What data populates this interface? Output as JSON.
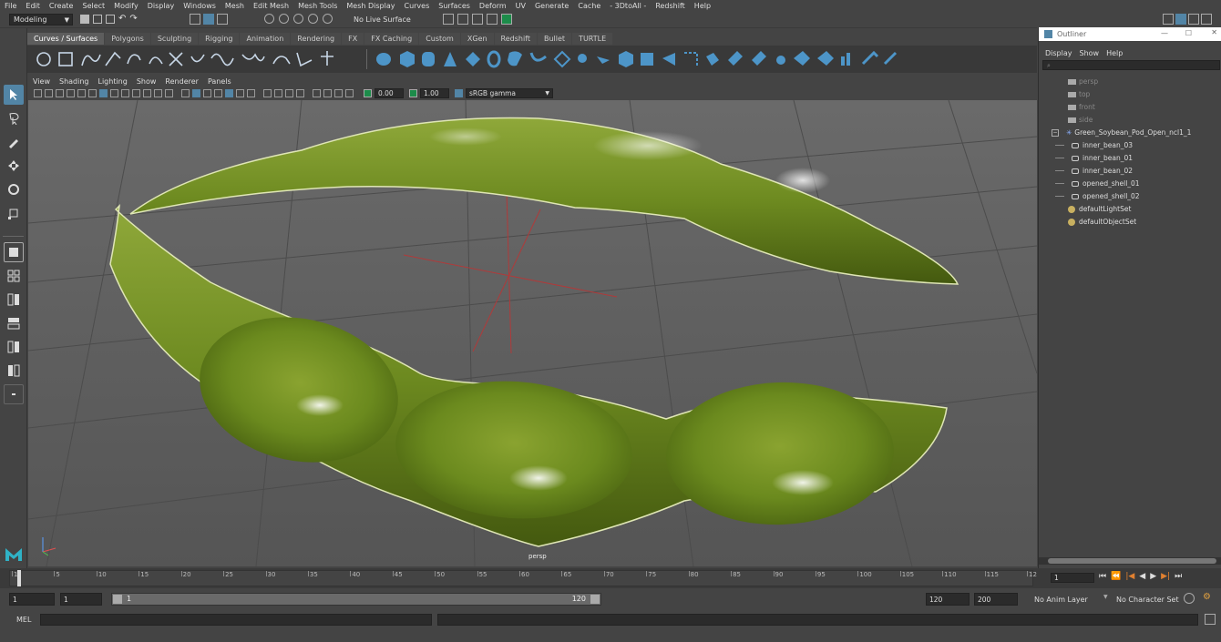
{
  "menu": [
    "File",
    "Edit",
    "Create",
    "Select",
    "Modify",
    "Display",
    "Windows",
    "Mesh",
    "Edit Mesh",
    "Mesh Tools",
    "Mesh Display",
    "Curves",
    "Surfaces",
    "Deform",
    "UV",
    "Generate",
    "Cache",
    "- 3DtoAll -",
    "Redshift",
    "Help"
  ],
  "status": {
    "mode": "Modeling",
    "live_surface": "No Live Surface"
  },
  "shelf_tabs": [
    "Curves / Surfaces",
    "Polygons",
    "Sculpting",
    "Rigging",
    "Animation",
    "Rendering",
    "FX",
    "FX Caching",
    "Custom",
    "XGen",
    "Redshift",
    "Bullet",
    "TURTLE"
  ],
  "panel_menu": [
    "View",
    "Shading",
    "Lighting",
    "Show",
    "Renderer",
    "Panels"
  ],
  "panel_tools": {
    "exposure": "0.00",
    "gamma": "1.00",
    "colorspace": "sRGB gamma"
  },
  "viewport": {
    "camera_label": "persp"
  },
  "outliner": {
    "title": "Outliner",
    "menu": [
      "Display",
      "Show",
      "Help"
    ],
    "cameras": [
      "persp",
      "top",
      "front",
      "side"
    ],
    "group": "Green_Soybean_Pod_Open_ncl1_1",
    "children": [
      "inner_bean_03",
      "inner_bean_01",
      "inner_bean_02",
      "opened_shell_01",
      "opened_shell_02"
    ],
    "sets": [
      "defaultLightSet",
      "defaultObjectSet"
    ]
  },
  "timeline": {
    "ticks": [
      "1",
      "5",
      "10",
      "15",
      "20",
      "25",
      "30",
      "35",
      "40",
      "45",
      "50",
      "55",
      "60",
      "65",
      "70",
      "75",
      "80",
      "85",
      "90",
      "95",
      "100",
      "105",
      "110",
      "115",
      "12"
    ],
    "current_frame": "1"
  },
  "range": {
    "start": "1",
    "playback_start": "1",
    "slider_start": "1",
    "slider_end": "120",
    "playback_end": "120",
    "end": "200",
    "anim_layer": "No Anim Layer",
    "char_set": "No Character Set"
  },
  "command": {
    "label": "MEL"
  },
  "colors": {
    "accent": "#5285a6",
    "viewport_bg": "#5d5d5d",
    "pod_green": "#6b8a1e"
  }
}
